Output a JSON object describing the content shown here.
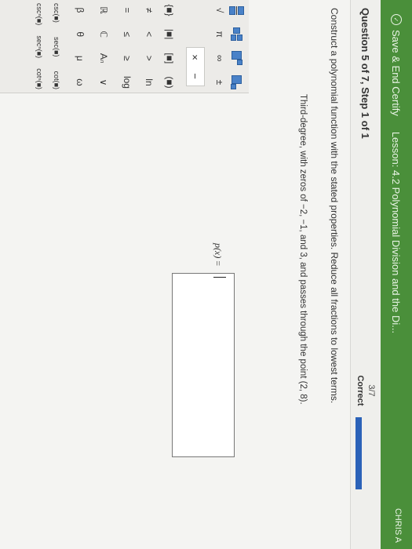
{
  "topbar": {
    "save_label": "Save & End Certify",
    "lesson": "Lesson: 4.2 Polynomial Division and the Di...",
    "user": "CHRIS A"
  },
  "question": {
    "title": "Question 5 of 7, Step 1 of 1",
    "score_fraction": "3/7",
    "score_status": "Correct",
    "progress_fraction": 0.43
  },
  "content": {
    "instruction": "Construct a polynomial function with the stated properties. Reduce all fractions to lowest terms.",
    "problem": "Third-degree, with zeros of −2, −1, and 3, and passes through the point (2, 8).",
    "answer_label": "p(x)",
    "answer_eq": "=",
    "answer_value": ""
  },
  "palette": {
    "clear_label": "×",
    "backspace_label": "−",
    "row_groups": [
      "{■}",
      "|■|",
      "[■]",
      "(■)"
    ],
    "row_relations1": [
      "≠",
      "<",
      ">",
      "ln"
    ],
    "row_relations2": [
      "=",
      "≤",
      "≥",
      "log"
    ],
    "row_sets": [
      "ℝ",
      "ℂ",
      "Aₙ",
      "∨"
    ],
    "row_greek": [
      "β",
      "θ",
      "μ",
      "ω"
    ],
    "row_trig1": [
      "csc(■)",
      "sec(■)",
      "cot(■)"
    ],
    "row_trig2": [
      "cscⁿ(■)",
      "secⁿ(■)",
      "cotⁿ(■)"
    ]
  },
  "colors": {
    "topbar": "#4a8f3a",
    "progress": "#2b62b8",
    "palette_blue": "#4a82c8"
  }
}
